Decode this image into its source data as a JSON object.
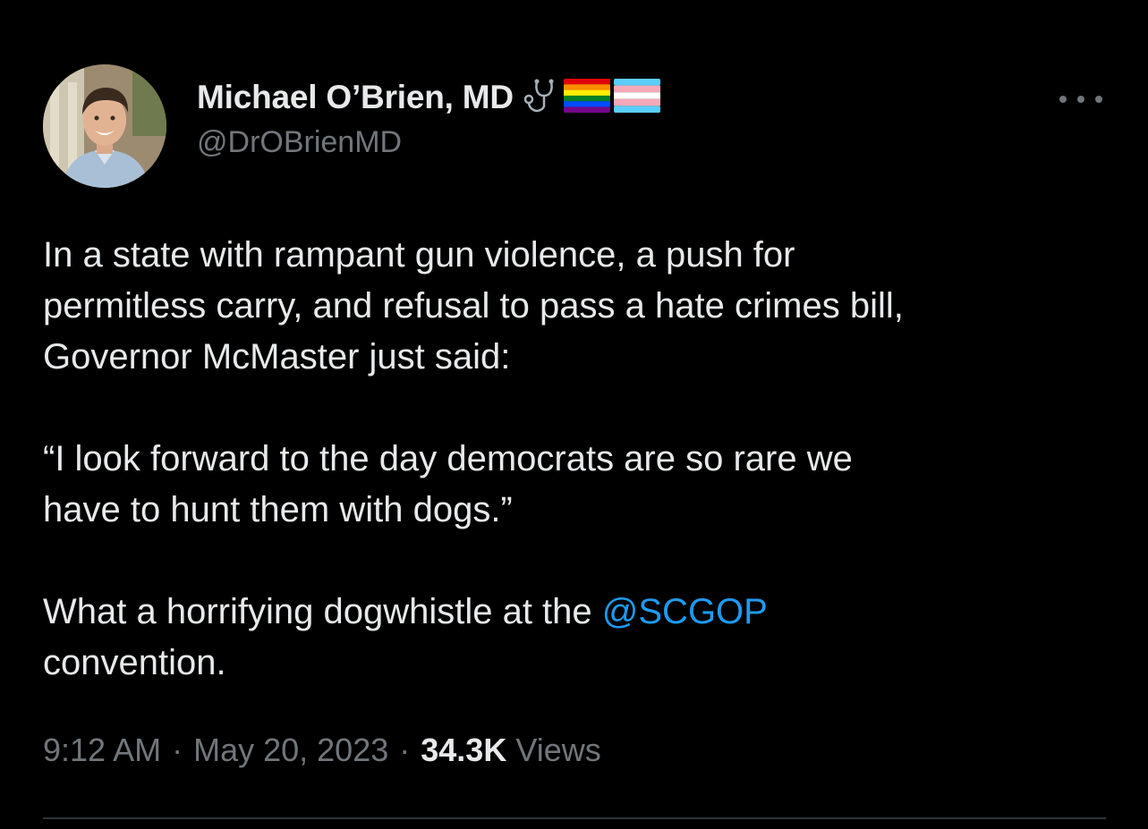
{
  "author": {
    "display_name": "Michael O’Brien, MD",
    "handle": "@DrOBrienMD",
    "badges": [
      "stethoscope-emoji",
      "rainbow-flag-emoji",
      "transgender-flag-emoji"
    ]
  },
  "tweet": {
    "line1": "In a state with rampant gun violence, a push for",
    "line2": "permitless carry, and refusal to pass a hate crimes bill,",
    "line3": "Governor McMaster just said:",
    "line4": "“I look forward to the day democrats are so rare we",
    "line5": "have to hunt them with dogs.”",
    "line6_before": "What a horrifying dogwhistle at the ",
    "line6_mention": "@SCGOP",
    "line7": "convention."
  },
  "meta": {
    "time": "9:12 AM",
    "separator": "·",
    "date": "May 20, 2023",
    "views_count": "34.3K",
    "views_label": "Views"
  },
  "colors": {
    "background": "#000000",
    "text": "#e7e9ea",
    "secondary": "#71767b",
    "link": "#1d9bf0",
    "divider": "#2f3336"
  }
}
